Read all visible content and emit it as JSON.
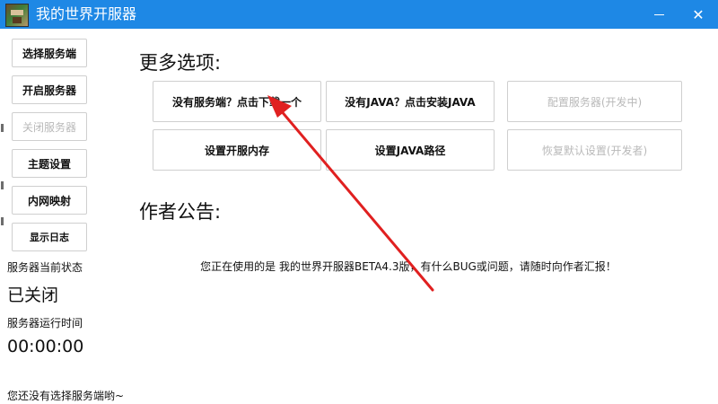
{
  "window": {
    "title": "我的世界开服器",
    "minimize_icon": "minimize-icon",
    "close_glyph": "✕",
    "accent_color": "#1e88e5"
  },
  "sidebar": {
    "buttons": [
      {
        "label": "选择服务端",
        "enabled": true
      },
      {
        "label": "开启服务器",
        "enabled": true
      },
      {
        "label": "关闭服务器",
        "enabled": false
      },
      {
        "label": "主题设置",
        "enabled": true
      },
      {
        "label": "内网映射",
        "enabled": true
      },
      {
        "label": "显示日志",
        "enabled": true
      }
    ],
    "status_label": "服务器当前状态",
    "status_value": "已关闭",
    "uptime_label": "服务器运行时间",
    "uptime_value": "00:00:00",
    "footer_hint": "您还没有选择服务端哟~"
  },
  "main": {
    "options_heading": "更多选项:",
    "options": [
      {
        "label": "没有服务端？点击下载一个",
        "enabled": true
      },
      {
        "label": "没有JAVA？点击安装JAVA",
        "enabled": true
      },
      {
        "label": "配置服务器(开发中)",
        "enabled": false
      },
      {
        "label": "设置开服内存",
        "enabled": true
      },
      {
        "label": "设置JAVA路径",
        "enabled": true
      },
      {
        "label": "恢复默认设置(开发者)",
        "enabled": false
      }
    ],
    "notice_heading": "作者公告:",
    "notice_text": "您正在使用的是 我的世界开服器BETA4.3版，有什么BUG或问题，请随时向作者汇报！"
  },
  "annotation": {
    "arrow_color": "#e02020"
  }
}
